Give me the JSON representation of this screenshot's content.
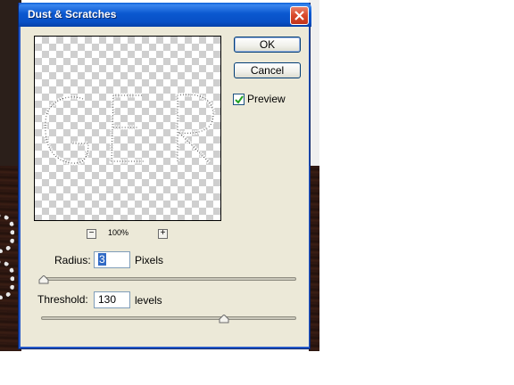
{
  "window": {
    "title": "Dust & Scratches"
  },
  "buttons": {
    "ok_label": "OK",
    "cancel_label": "Cancel"
  },
  "preview_toggle": {
    "label": "Preview",
    "checked": true
  },
  "zoom": {
    "level": "100%",
    "zoom_out_symbol": "−",
    "zoom_in_symbol": "+"
  },
  "radius": {
    "label": "Radius:",
    "value": "3",
    "unit": "Pixels",
    "slider_fraction": 0.0
  },
  "threshold": {
    "label": "Threshold:",
    "value": "130",
    "unit": "levels",
    "slider_fraction": 0.72
  },
  "icons": {
    "close": "close-icon",
    "checkbox": "checkmark-icon"
  },
  "colors": {
    "title_bar": "#0b58d0",
    "dialog_face": "#ece9d8",
    "selection": "#316ac5",
    "close_button": "#d9482a"
  }
}
